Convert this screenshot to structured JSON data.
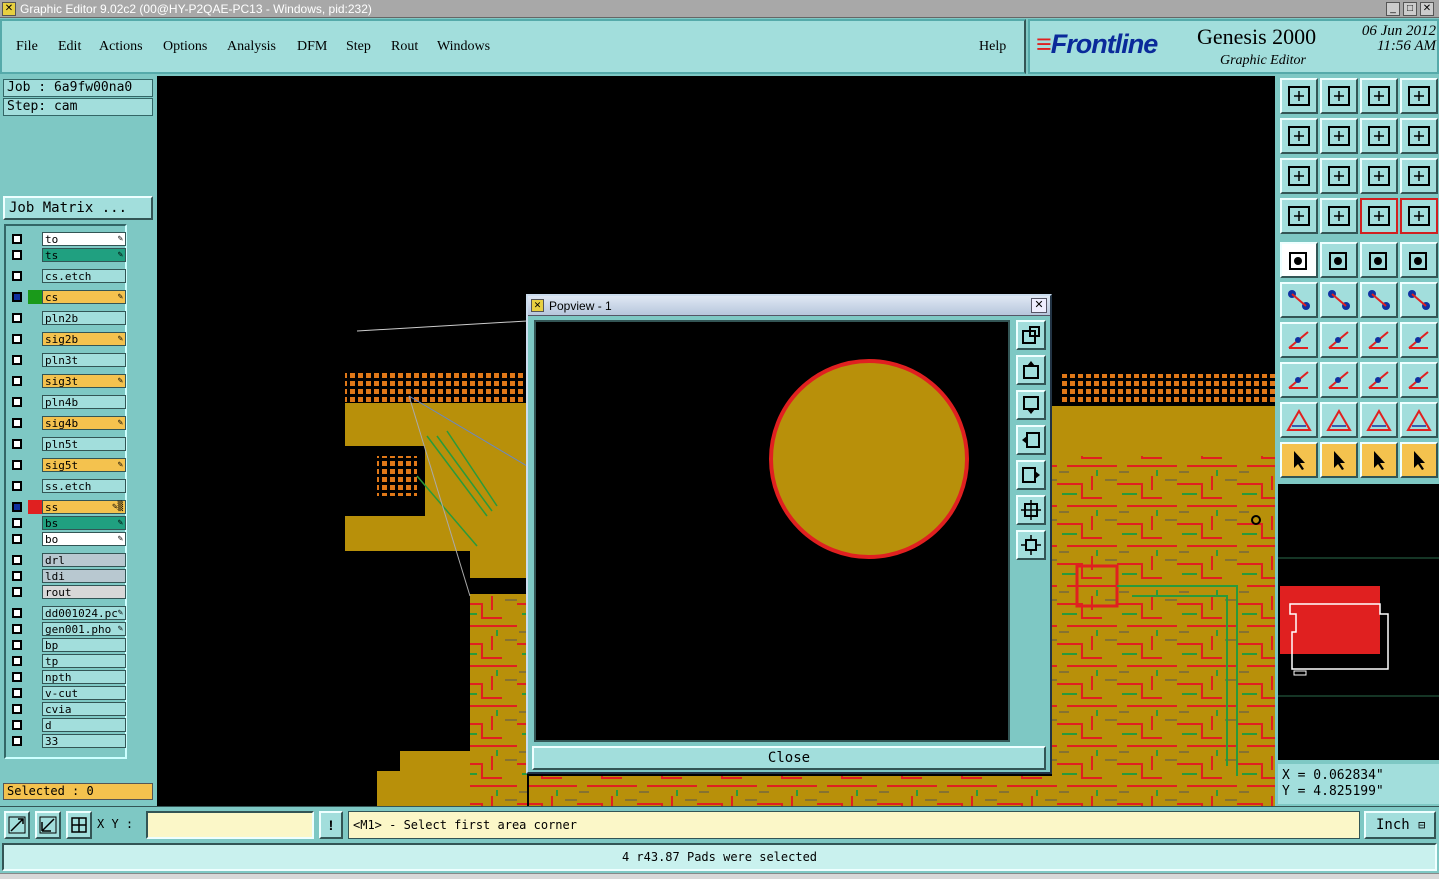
{
  "window": {
    "title": "Graphic Editor 9.02c2 (00@HY-P2QAE-PC13 - Windows, pid:232)"
  },
  "menu": {
    "items": [
      "File",
      "Edit",
      "Actions",
      "Options",
      "Analysis",
      "DFM",
      "Step",
      "Rout",
      "Windows"
    ],
    "help": "Help"
  },
  "brand": {
    "logo": "Frontline",
    "product": "Genesis 2000",
    "subtitle": "Graphic Editor",
    "date": "06 Jun 2012",
    "time": "11:56 AM"
  },
  "job": {
    "job_label": "Job : 6a9fw00na0",
    "step_label": "Step: cam",
    "matrix_button": "Job Matrix ..."
  },
  "layers": [
    {
      "name": "to",
      "color": "#ffffff",
      "swatch": "",
      "mark": "✎"
    },
    {
      "name": "ts",
      "color": "#20a080",
      "swatch": "",
      "mark": "✎"
    },
    {
      "name": "cs.etch",
      "color": "#a2dedc",
      "swatch": "",
      "mark": ""
    },
    {
      "name": "cs",
      "color": "#f4c24e",
      "swatch": "#1a9a1a",
      "mark": "✎"
    },
    {
      "name": "pln2b",
      "color": "#a2dedc",
      "swatch": "",
      "mark": ""
    },
    {
      "name": "sig2b",
      "color": "#f4c24e",
      "swatch": "",
      "mark": "✎"
    },
    {
      "name": "pln3t",
      "color": "#a2dedc",
      "swatch": "",
      "mark": ""
    },
    {
      "name": "sig3t",
      "color": "#f4c24e",
      "swatch": "",
      "mark": "✎"
    },
    {
      "name": "pln4b",
      "color": "#a2dedc",
      "swatch": "",
      "mark": ""
    },
    {
      "name": "sig4b",
      "color": "#f4c24e",
      "swatch": "",
      "mark": "✎"
    },
    {
      "name": "pln5t",
      "color": "#a2dedc",
      "swatch": "",
      "mark": ""
    },
    {
      "name": "sig5t",
      "color": "#f4c24e",
      "swatch": "",
      "mark": "✎"
    },
    {
      "name": "ss.etch",
      "color": "#a2dedc",
      "swatch": "",
      "mark": ""
    },
    {
      "name": "ss",
      "color": "#f4c24e",
      "swatch": "#e02020",
      "mark": "✎▒"
    },
    {
      "name": "bs",
      "color": "#20a080",
      "swatch": "",
      "mark": "✎"
    },
    {
      "name": "bo",
      "color": "#ffffff",
      "swatch": "",
      "mark": "✎"
    },
    {
      "name": "drl",
      "color": "#b8c8d0",
      "swatch": "",
      "mark": ""
    },
    {
      "name": "ldi",
      "color": "#b8c8d0",
      "swatch": "",
      "mark": ""
    },
    {
      "name": "rout",
      "color": "#d8d8d8",
      "swatch": "",
      "mark": ""
    },
    {
      "name": "dd001024.pc",
      "color": "#a2dedc",
      "swatch": "",
      "mark": "✎"
    },
    {
      "name": "gen001.pho",
      "color": "#a2dedc",
      "swatch": "",
      "mark": "✎"
    },
    {
      "name": "bp",
      "color": "#a2dedc",
      "swatch": "",
      "mark": ""
    },
    {
      "name": "tp",
      "color": "#a2dedc",
      "swatch": "",
      "mark": ""
    },
    {
      "name": "npth",
      "color": "#a2dedc",
      "swatch": "",
      "mark": ""
    },
    {
      "name": "v-cut",
      "color": "#a2dedc",
      "swatch": "",
      "mark": ""
    },
    {
      "name": "cvia",
      "color": "#a2dedc",
      "swatch": "",
      "mark": ""
    },
    {
      "name": "d",
      "color": "#a2dedc",
      "swatch": "",
      "mark": ""
    },
    {
      "name": "33",
      "color": "#a2dedc",
      "swatch": "",
      "mark": ""
    }
  ],
  "selected": "Selected : 0",
  "popview": {
    "title": "Popview - 1",
    "close_label": "Close"
  },
  "coords": {
    "x": "X = 0.062834\"",
    "y": "Y = 4.825199\""
  },
  "bottom": {
    "xy_label": "X Y :",
    "xy_value": "",
    "prompt": "<M1> - Select first area corner",
    "units": "Inch",
    "status": "4 r43.87 Pads were selected"
  },
  "colors": {
    "board": "#b8900a",
    "trace_red": "#e02020",
    "trace_green": "#2a9a3a",
    "panel": "#a2dedc"
  }
}
